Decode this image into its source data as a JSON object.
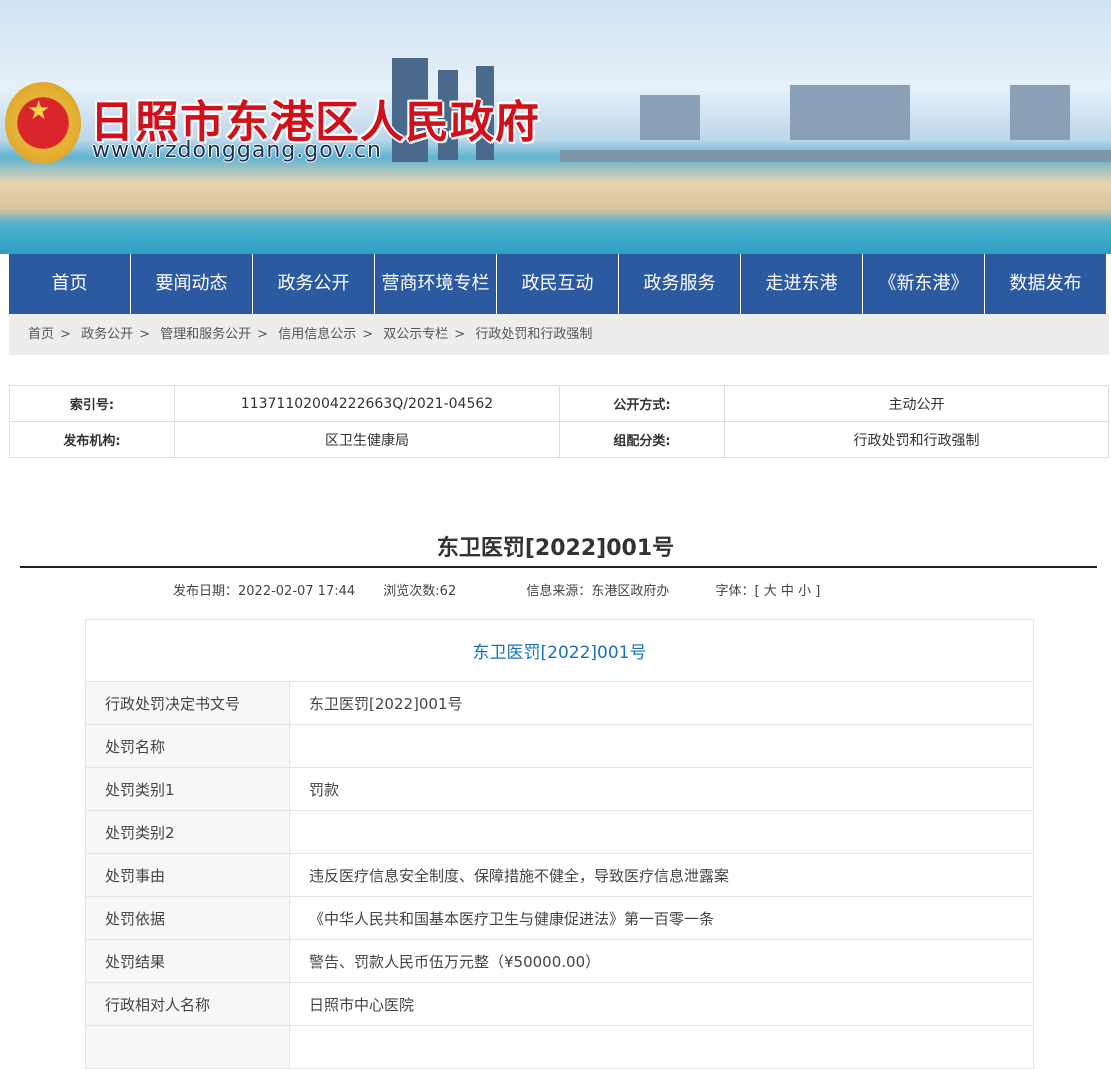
{
  "header": {
    "title": "日照市东港区人民政府",
    "url": "www.rzdonggang.gov.cn"
  },
  "nav": [
    "首页",
    "要闻动态",
    "政务公开",
    "营商环境专栏",
    "政民互动",
    "政务服务",
    "走进东港",
    "《新东港》",
    "数据发布"
  ],
  "breadcrumb": [
    "首页",
    "政务公开",
    "管理和服务公开",
    "信用信息公示",
    "双公示专栏",
    "行政处罚和行政强制"
  ],
  "info": {
    "index_label": "索引号:",
    "index_value": "11371102004222663Q/2021-04562",
    "mode_label": "公开方式:",
    "mode_value": "主动公开",
    "org_label": "发布机构:",
    "org_value": "区卫生健康局",
    "cat_label": "组配分类:",
    "cat_value": "行政处罚和行政强制"
  },
  "article": {
    "title": "东卫医罚[2022]001号",
    "date": "发布日期：2022-02-07 17:44",
    "views": "浏览次数:62",
    "source": "信息来源：东港区政府办",
    "font_label": "字体：[",
    "font_large": "大",
    "font_medium": "中",
    "font_small": "小",
    "font_end": "]"
  },
  "doc": {
    "heading": "东卫医罚[2022]001号",
    "rows": [
      {
        "k": "行政处罚决定书文号",
        "v": "东卫医罚[2022]001号"
      },
      {
        "k": "处罚名称",
        "v": ""
      },
      {
        "k": "处罚类别1",
        "v": "罚款"
      },
      {
        "k": "处罚类别2",
        "v": ""
      },
      {
        "k": "处罚事由",
        "v": "违反医疗信息安全制度、保障措施不健全，导致医疗信息泄露案"
      },
      {
        "k": "处罚依据",
        "v": "《中华人民共和国基本医疗卫生与健康促进法》第一百零一条"
      },
      {
        "k": "处罚结果",
        "v": "警告、罚款人民币伍万元整（¥50000.00）"
      },
      {
        "k": "行政相对人名称",
        "v": "日照市中心医院"
      },
      {
        "k": "",
        "v": ""
      }
    ]
  }
}
